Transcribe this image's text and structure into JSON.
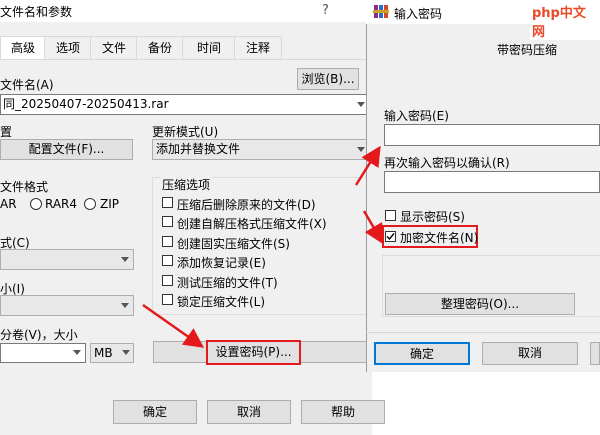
{
  "dialog": {
    "title": "文件名和参数",
    "help_mark": "?",
    "tabs": [
      "高级",
      "选项",
      "文件",
      "备份",
      "时间",
      "注释"
    ],
    "archive_name_label": "文件名(A)",
    "archive_name_value": "同_20250407-20250413.rar",
    "browse_label": "浏览(B)...",
    "profile_label": "置",
    "profile_button": "配置文件(F)...",
    "update_mode_label": "更新模式(U)",
    "update_mode_value": "添加并替换文件",
    "format_label": "文件格式",
    "format_options": [
      "AR",
      "RAR4",
      "ZIP"
    ],
    "compress_method_label": "式(C)",
    "dict_size_label": "小(I)",
    "split_label": "分卷(V)，大小",
    "unit_value": "MB",
    "options_group_label": "压缩选项",
    "options": [
      "压缩后删除原来的文件(D)",
      "创建自解压格式压缩文件(X)",
      "创建固实压缩文件(S)",
      "添加恢复记录(E)",
      "测试压缩的文件(T)",
      "锁定压缩文件(L)"
    ],
    "set_password_button": "设置密码(P)...",
    "ok_button": "确定",
    "cancel_button": "取消",
    "help_button": "帮助"
  },
  "password_dialog": {
    "title": "输入密码",
    "subtitle": "带密码压缩",
    "enter_password_label": "输入密码(E)",
    "reenter_password_label": "再次输入密码以确认(R)",
    "show_password_label": "显示密码(S)",
    "encrypt_names_label": "加密文件名(N)",
    "organize_button": "整理密码(O)...",
    "ok_button": "确定",
    "cancel_button": "取消"
  },
  "watermark": "php中文网",
  "colors": {
    "highlight": "#e3191c",
    "button_bg": "#e1e1e1",
    "dialog_bg": "#f0f0f0"
  }
}
